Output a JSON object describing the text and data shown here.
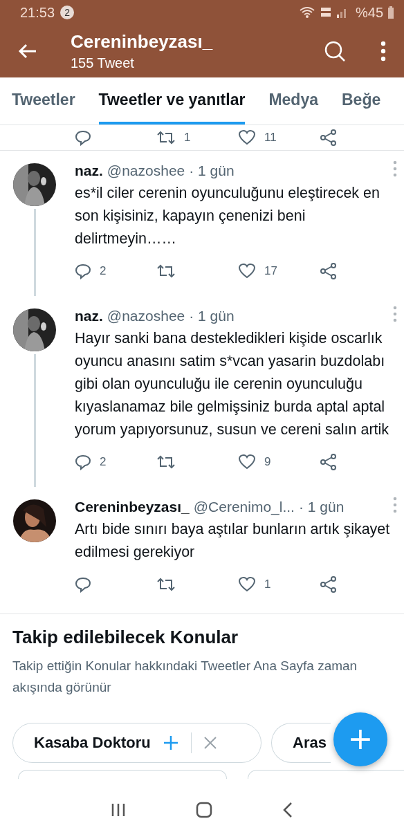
{
  "status_bar": {
    "time": "21:53",
    "notification_count": "2",
    "battery": "%45"
  },
  "header": {
    "title": "Cereninbeyzası_",
    "subtitle": "155 Tweet"
  },
  "tabs": [
    {
      "label": "Tweetler",
      "selected": false
    },
    {
      "label": "Tweetler ve yanıtlar",
      "selected": true
    },
    {
      "label": "Medya",
      "selected": false
    },
    {
      "label": "Beğe",
      "selected": false
    }
  ],
  "partial_tweet": {
    "retweets": "1",
    "likes": "11"
  },
  "tweets": [
    {
      "name": "naz.",
      "handle": "@nazoshee",
      "time": "· 1 gün",
      "text": "es*il ciler cerenin oyunculuğunu eleştirecek en son kişisiniz, kapayın çenenizi beni delirtmeyin……",
      "replies": "2",
      "likes": "17",
      "thread_below": true
    },
    {
      "name": "naz.",
      "handle": "@nazoshee",
      "time": "· 1 gün",
      "text": "Hayır sanki bana destekledikleri kişide oscarlık oyuncu anasını satim s*vcan yasarin buzdolabı gibi olan oyunculuğu ile cerenin oyunculuğu kıyaslanamaz bile gelmişsiniz burda aptal aptal yorum yapıyorsunuz, susun ve cereni salın artik",
      "replies": "2",
      "likes": "9",
      "thread_below": true
    },
    {
      "name": "Cereninbeyzası_",
      "handle": "@Cerenimo_l...",
      "time": "· 1 gün",
      "text": "Artı bide sınırı baya aştılar bunların artık şikayet edilmesi gerekiyor",
      "likes": "1",
      "thread_below": false
    }
  ],
  "topics": {
    "title": "Takip edilebilecek Konular",
    "description": "Takip ettiğin Konular hakkındaki Tweetler Ana Sayfa zaman akışında görünür",
    "chips": [
      {
        "label": "Kasaba Doktoru"
      },
      {
        "label": "Aras"
      }
    ]
  },
  "fab": {
    "label": "+"
  }
}
